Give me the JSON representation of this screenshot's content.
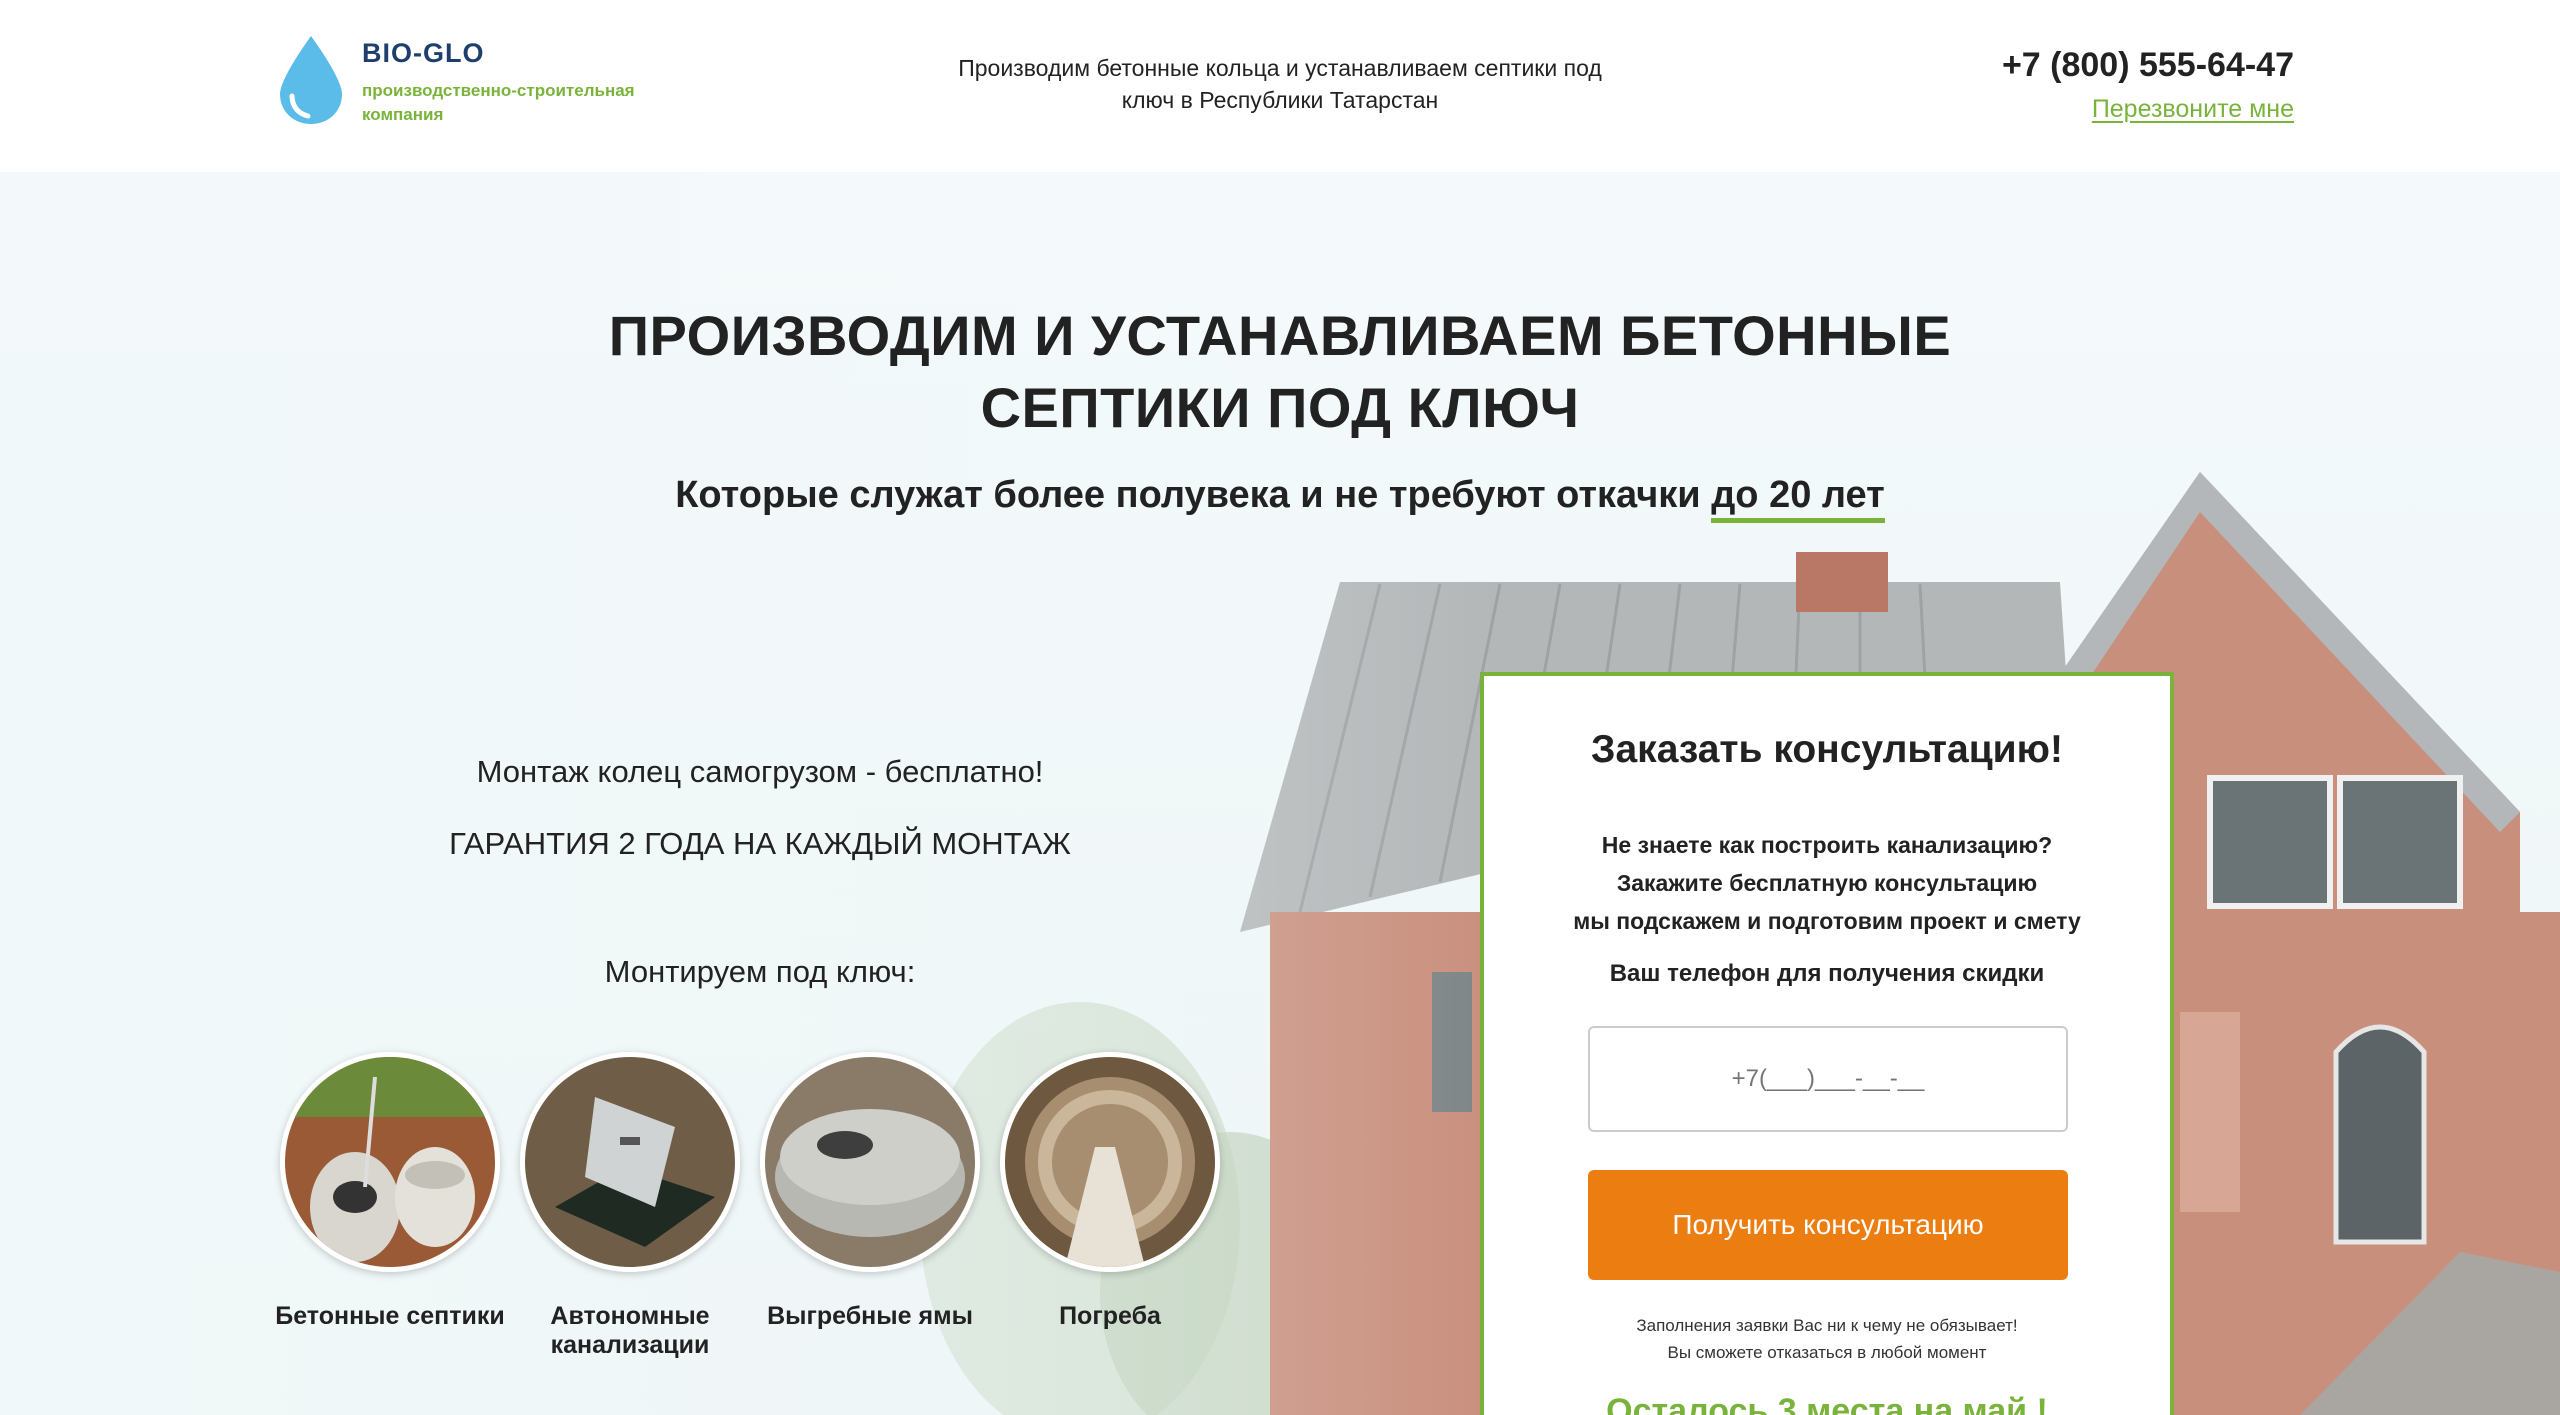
{
  "header": {
    "logo_name": "BIO-GLO",
    "logo_subtitle": "производственно-строительная компания",
    "tagline": "Производим бетонные кольца и устанавливаем септики под ключ в Республики Татарстан",
    "phone": "+7 (800) 555-64-47",
    "callback_label": "Перезвоните мне"
  },
  "hero": {
    "title": "ПРОИЗВОДИМ И УСТАНАВЛИВАЕМ БЕТОННЫЕ СЕПТИКИ ПОД КЛЮЧ",
    "subtitle_prefix": "Которые служат более полувека и не требуют откачки ",
    "subtitle_highlight": "до 20 лет",
    "perk_1": "Монтаж колец самогрузом - бесплатно!",
    "perk_2": "ГАРАНТИЯ 2 ГОДА НА КАЖДЫЙ МОНТАЖ",
    "turnkey_heading": "Монтируем под ключ:",
    "services": [
      {
        "label": "Бетонные септики"
      },
      {
        "label": "Автономные канализации"
      },
      {
        "label": "Выгребные ямы"
      },
      {
        "label": "Погреба"
      }
    ]
  },
  "form": {
    "title": "Заказать консультацию!",
    "desc_line1": "Не знаете как построить канализацию?",
    "desc_line2": "Закажите бесплатную консультацию",
    "desc_line3": "мы подскажем и подготовим проект и смету",
    "phone_label": "Ваш телефон для получения скидки",
    "phone_placeholder": "+7(___)___-__-__",
    "submit_label": "Получить консультацию",
    "note_line1": "Заполнения заявки Вас ни к чему не обязывает!",
    "note_line2": "Вы сможете отказаться в любой момент",
    "limited": "Осталось 3 места на май !"
  },
  "colors": {
    "accent_green": "#7ab33c",
    "brand_blue": "#1e3f6e",
    "button_orange": "#ec7d10",
    "drop_blue": "#5bbcea"
  }
}
